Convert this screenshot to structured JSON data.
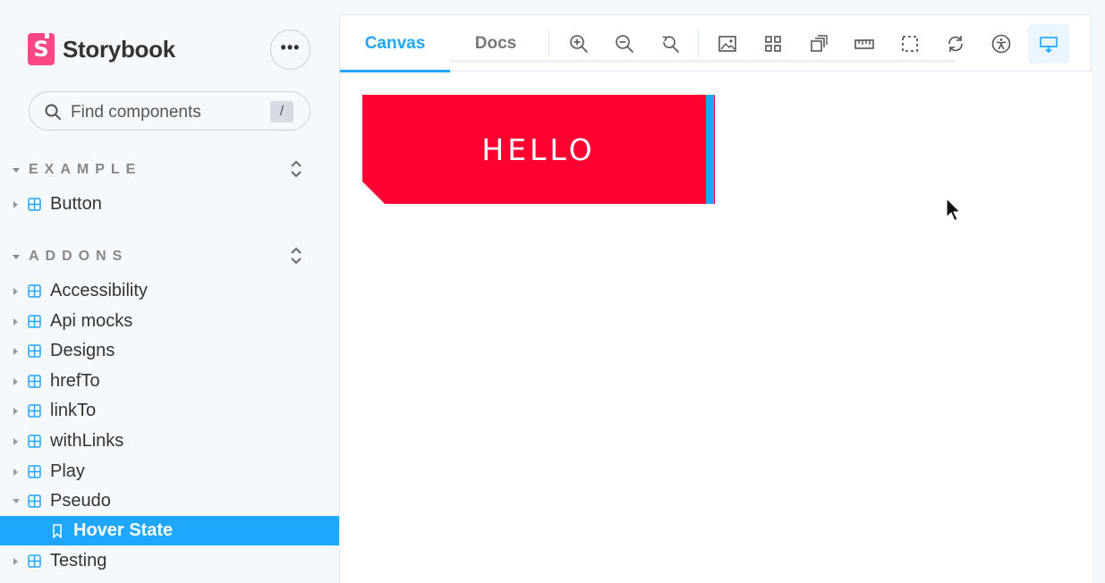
{
  "brand": {
    "name": "Storybook",
    "logo_letter": "S"
  },
  "menu": {
    "dots": "•••"
  },
  "search": {
    "placeholder": "Find components",
    "shortcut": "/"
  },
  "sections": [
    {
      "label": "EXAMPLE",
      "items": [
        {
          "label": "Button"
        }
      ]
    },
    {
      "label": "ADDONS",
      "items": [
        {
          "label": "Accessibility"
        },
        {
          "label": "Api mocks"
        },
        {
          "label": "Designs"
        },
        {
          "label": "hrefTo"
        },
        {
          "label": "linkTo"
        },
        {
          "label": "withLinks"
        },
        {
          "label": "Play"
        },
        {
          "label": "Pseudo",
          "expanded": true
        },
        {
          "label": "Hover State",
          "selected": true,
          "type": "story"
        },
        {
          "label": "Testing"
        }
      ]
    }
  ],
  "tabs": [
    {
      "label": "Canvas",
      "active": true
    },
    {
      "label": "Docs",
      "active": false
    }
  ],
  "tools": [
    "zoom-in-icon",
    "zoom-out-icon",
    "zoom-reset-icon",
    "background-icon",
    "grid-icon",
    "viewport-icon",
    "measure-icon",
    "outline-icon",
    "remount-icon",
    "accessibility-icon",
    "addons-panel-icon"
  ],
  "preview": {
    "button_label": "HELLO"
  },
  "colors": {
    "accent": "#1ea7fd",
    "button_bg": "#ff0033",
    "brand": "#ff4785"
  }
}
